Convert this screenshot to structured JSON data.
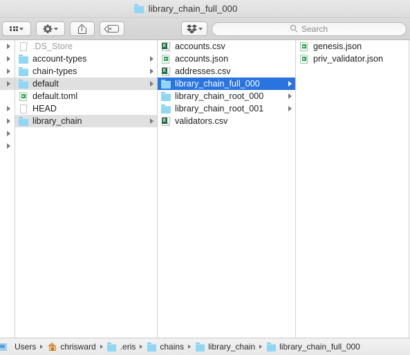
{
  "window": {
    "title": "library_chain_full_000",
    "title_icon": "folder-icon"
  },
  "toolbar": {
    "view_button": {
      "label": "",
      "icon": "grid-view-icon",
      "chevron": "chevron-down-icon"
    },
    "action_button": {
      "label": "",
      "icon": "gear-icon",
      "chevron": "chevron-down-icon"
    },
    "share_button": {
      "label": "",
      "icon": "share-icon"
    },
    "tag_button": {
      "label": "",
      "icon": "tag-icon"
    },
    "dropbox_button": {
      "label": "",
      "icon": "dropbox-icon",
      "chevron": "chevron-down-icon"
    },
    "search": {
      "placeholder": "Search",
      "value": "",
      "icon": "search-icon"
    }
  },
  "colors": {
    "selection_blue": "#2a74e0",
    "selection_gray": "#e0e0e0",
    "folder_blue": "#8fd7f5",
    "toolbar_gray": "#d8d8d8",
    "json_green": "#2f9e4f",
    "csv_green": "#1d7044"
  },
  "browser": {
    "stub_column": {
      "rows": [
        {
          "disclosure": true
        },
        {
          "disclosure": true
        },
        {
          "disclosure": true
        },
        {
          "disclosure": true,
          "highlighted": true
        },
        {
          "disclosure": false
        },
        {
          "disclosure": true
        },
        {
          "disclosure": true
        },
        {
          "disclosure": true
        },
        {
          "disclosure": true
        }
      ]
    },
    "columns": [
      {
        "name": "column-one",
        "items": [
          {
            "label": ".DS_Store",
            "icon": "document-icon",
            "type": "file",
            "dim": true,
            "disclosure": false,
            "selected": "none"
          },
          {
            "label": "account-types",
            "icon": "folder-icon",
            "type": "folder",
            "dim": false,
            "disclosure": true,
            "selected": "none"
          },
          {
            "label": "chain-types",
            "icon": "folder-icon",
            "type": "folder",
            "dim": false,
            "disclosure": true,
            "selected": "none"
          },
          {
            "label": "default",
            "icon": "folder-icon",
            "type": "folder",
            "dim": false,
            "disclosure": true,
            "selected": "gray"
          },
          {
            "label": "default.toml",
            "icon": "json-icon",
            "type": "file",
            "dim": false,
            "disclosure": false,
            "selected": "none"
          },
          {
            "label": "HEAD",
            "icon": "document-icon",
            "type": "file",
            "dim": false,
            "disclosure": false,
            "selected": "none"
          },
          {
            "label": "library_chain",
            "icon": "folder-icon",
            "type": "folder",
            "dim": false,
            "disclosure": true,
            "selected": "gray"
          }
        ]
      },
      {
        "name": "column-two",
        "items": [
          {
            "label": "accounts.csv",
            "icon": "csv-icon",
            "type": "file",
            "dim": false,
            "disclosure": false,
            "selected": "none"
          },
          {
            "label": "accounts.json",
            "icon": "json-icon",
            "type": "file",
            "dim": false,
            "disclosure": false,
            "selected": "none"
          },
          {
            "label": "addresses.csv",
            "icon": "csv-icon",
            "type": "file",
            "dim": false,
            "disclosure": false,
            "selected": "none"
          },
          {
            "label": "library_chain_full_000",
            "icon": "folder-icon",
            "type": "folder",
            "dim": false,
            "disclosure": true,
            "selected": "blue"
          },
          {
            "label": "library_chain_root_000",
            "icon": "folder-icon",
            "type": "folder",
            "dim": false,
            "disclosure": true,
            "selected": "none"
          },
          {
            "label": "library_chain_root_001",
            "icon": "folder-icon",
            "type": "folder",
            "dim": false,
            "disclosure": true,
            "selected": "none"
          },
          {
            "label": "validators.csv",
            "icon": "csv-icon",
            "type": "file",
            "dim": false,
            "disclosure": false,
            "selected": "none"
          }
        ]
      },
      {
        "name": "column-three",
        "items": [
          {
            "label": "genesis.json",
            "icon": "json-icon",
            "type": "file",
            "dim": false,
            "disclosure": false,
            "selected": "none"
          },
          {
            "label": "priv_validator.json",
            "icon": "json-icon",
            "type": "file",
            "dim": false,
            "disclosure": false,
            "selected": "none"
          }
        ]
      }
    ]
  },
  "pathbar": {
    "crumbs": [
      {
        "label": "Users",
        "icon": "users-folder-icon"
      },
      {
        "label": "chrisward",
        "icon": "home-icon"
      },
      {
        "label": ".eris",
        "icon": "folder-icon"
      },
      {
        "label": "chains",
        "icon": "folder-icon"
      },
      {
        "label": "library_chain",
        "icon": "folder-icon"
      },
      {
        "label": "library_chain_full_000",
        "icon": "folder-icon"
      }
    ]
  }
}
